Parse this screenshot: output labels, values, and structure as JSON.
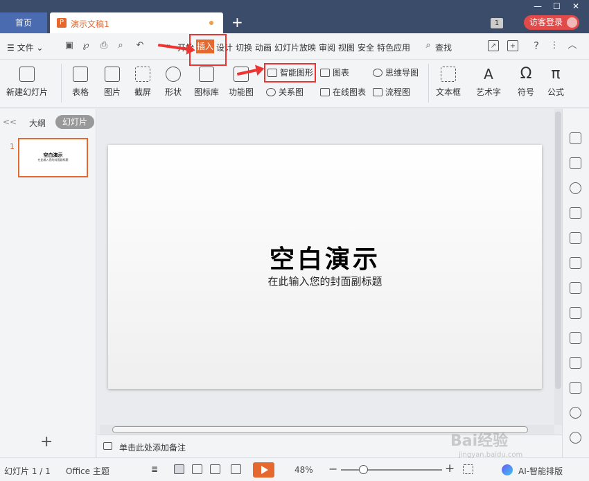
{
  "titlebar": {
    "home_tab": "首页",
    "doc_tab": "演示文稿1",
    "doc_icon": "P",
    "new_tab": "+",
    "badge": "1",
    "login": "访客登录",
    "minimize": "—",
    "maximize": "☐",
    "close": "✕"
  },
  "menubar": {
    "file": "☰ 文件 ⌄",
    "undo": "↶",
    "more": "»",
    "tabs": [
      "开始",
      "插入",
      "设计",
      "切换",
      "动画",
      "幻灯片放映",
      "审阅",
      "视图",
      "安全",
      "特色应用"
    ],
    "search": "查找",
    "help": "?",
    "more_menu": "⋮",
    "collapse": "︿"
  },
  "ribbon": {
    "new_slide": "新建幻灯片",
    "table": "表格",
    "picture": "图片",
    "screenshot": "截屏",
    "shape": "形状",
    "icon_lib": "图标库",
    "func_chart": "功能图",
    "smart_art": "智能图形",
    "relation": "关系图",
    "chart": "图表",
    "online_chart": "在线图表",
    "mind_map": "思维导图",
    "flow_chart": "流程图",
    "textbox": "文本框",
    "wordart": "艺术字",
    "symbol": "符号",
    "formula": "公式",
    "symbol_glyph": "Ω",
    "formula_glyph": "π"
  },
  "leftpanel": {
    "collapse": "<<",
    "outline": "大纲",
    "slides": "幻灯片",
    "thumb_num": "1",
    "thumb_title": "空白演示",
    "thumb_sub": "在此输入您的封面副标题",
    "add": "+"
  },
  "slide": {
    "title": "空白演示",
    "subtitle": "在此输入您的封面副标题"
  },
  "notes": {
    "text": "单击此处添加备注"
  },
  "statusbar": {
    "slide_count": "幻灯片 1 / 1",
    "theme": "Office 主题",
    "zoom": "48%",
    "zoom_minus": "−",
    "zoom_plus": "+",
    "ai": "AI-智能排版"
  },
  "watermark": {
    "text": "Bai经验",
    "sub": "jingyan.baidu.com"
  }
}
